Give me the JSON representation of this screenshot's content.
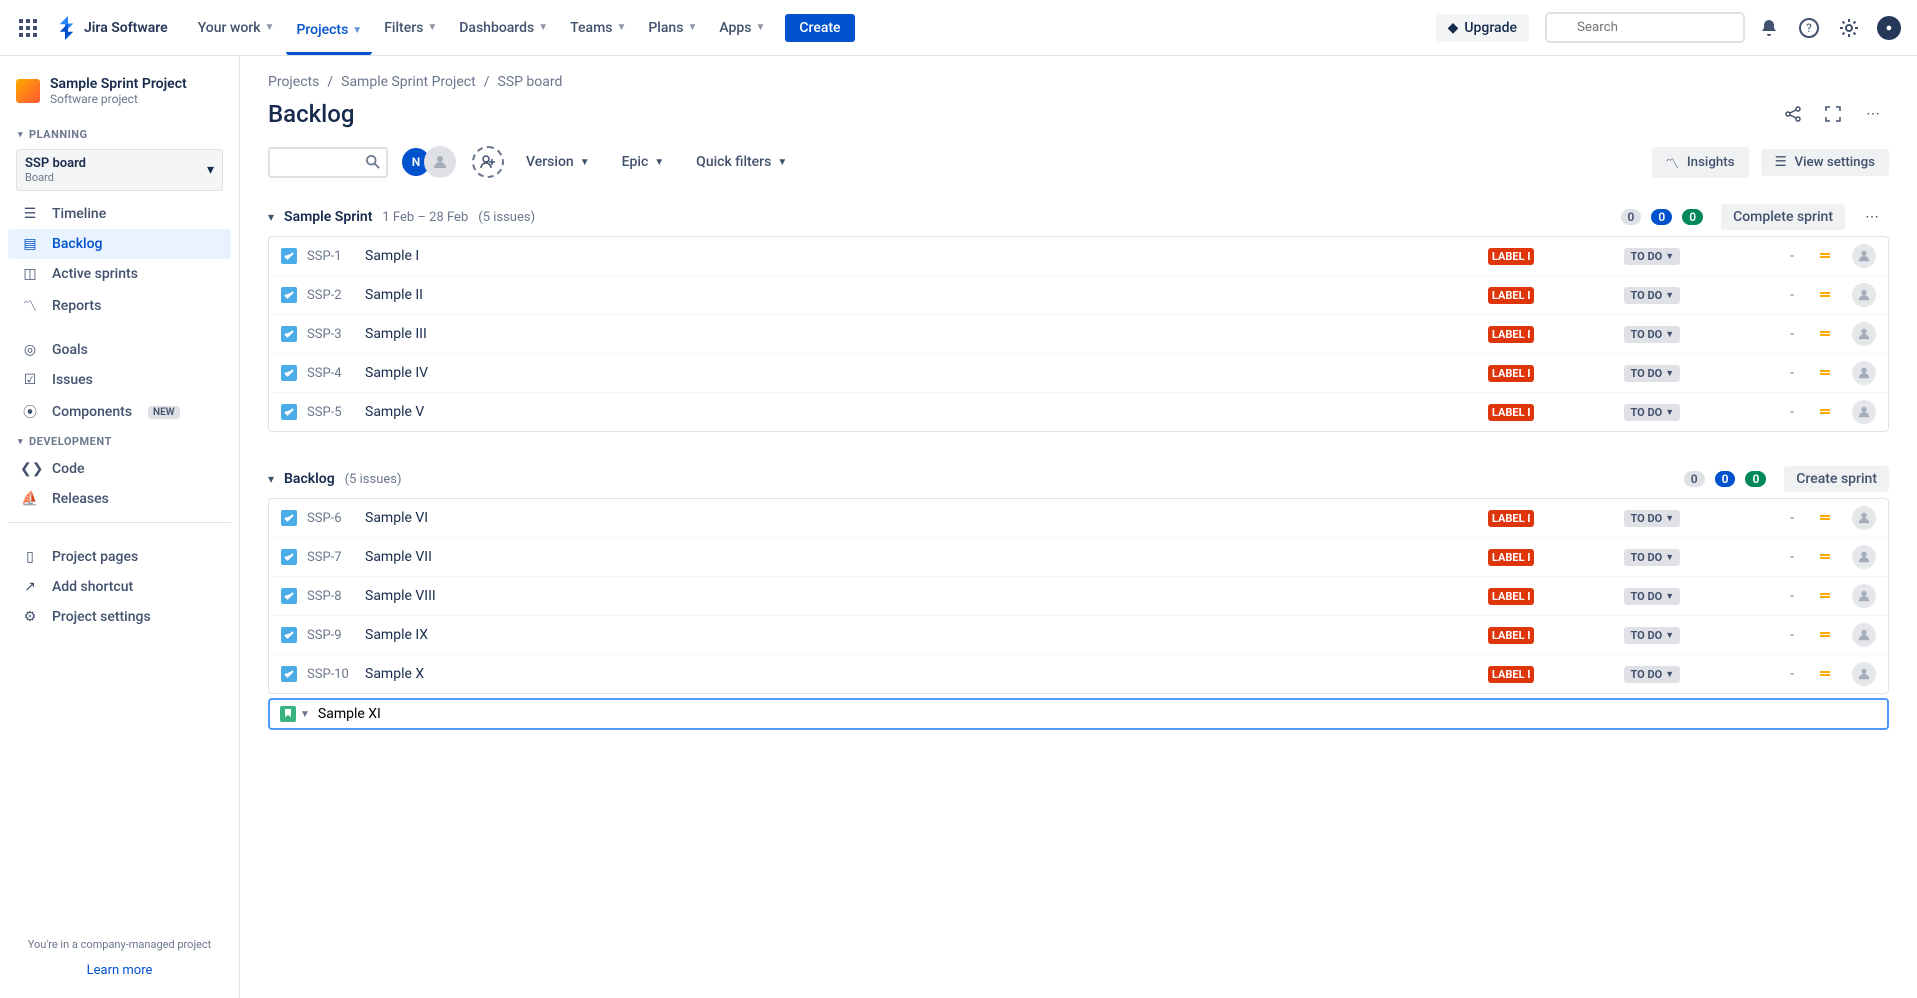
{
  "nav": {
    "logo_text": "Jira Software",
    "your_work": "Your work",
    "projects": "Projects",
    "filters": "Filters",
    "dashboards": "Dashboards",
    "teams": "Teams",
    "plans": "Plans",
    "apps": "Apps",
    "create": "Create",
    "upgrade": "Upgrade",
    "search_placeholder": "Search"
  },
  "sidebar": {
    "project_title": "Sample Sprint Project",
    "project_sub": "Software project",
    "planning": "PLANNING",
    "board_select": {
      "title": "SSP board",
      "sub": "Board"
    },
    "timeline": "Timeline",
    "backlog": "Backlog",
    "active_sprints": "Active sprints",
    "reports": "Reports",
    "goals": "Goals",
    "issues": "Issues",
    "components": "Components",
    "new_badge": "NEW",
    "development": "DEVELOPMENT",
    "code": "Code",
    "releases": "Releases",
    "project_pages": "Project pages",
    "add_shortcut": "Add shortcut",
    "project_settings": "Project settings",
    "footer": "You're in a company-managed project",
    "learn_more": "Learn more"
  },
  "breadcrumb": {
    "projects": "Projects",
    "project": "Sample Sprint Project",
    "board": "SSP board"
  },
  "page": {
    "title": "Backlog",
    "version": "Version",
    "epic": "Epic",
    "quick_filters": "Quick filters",
    "insights": "Insights",
    "view_settings": "View settings"
  },
  "sprint": {
    "name": "Sample Sprint",
    "dates": "1 Feb – 28 Feb",
    "count": "(5 issues)",
    "todo": "0",
    "inprog": "0",
    "done": "0",
    "complete": "Complete sprint",
    "issues": [
      {
        "key": "SSP-1",
        "summary": "Sample I",
        "label": "LABEL I",
        "status": "TO DO",
        "est": "-"
      },
      {
        "key": "SSP-2",
        "summary": "Sample II",
        "label": "LABEL I",
        "status": "TO DO",
        "est": "-"
      },
      {
        "key": "SSP-3",
        "summary": "Sample III",
        "label": "LABEL I",
        "status": "TO DO",
        "est": "-"
      },
      {
        "key": "SSP-4",
        "summary": "Sample IV",
        "label": "LABEL I",
        "status": "TO DO",
        "est": "-"
      },
      {
        "key": "SSP-5",
        "summary": "Sample V",
        "label": "LABEL I",
        "status": "TO DO",
        "est": "-"
      }
    ]
  },
  "backlog": {
    "name": "Backlog",
    "count": "(5 issues)",
    "todo": "0",
    "inprog": "0",
    "done": "0",
    "create_sprint": "Create sprint",
    "new_issue_value": "Sample XI",
    "issues": [
      {
        "key": "SSP-6",
        "summary": "Sample VI",
        "label": "LABEL I",
        "status": "TO DO",
        "est": "-"
      },
      {
        "key": "SSP-7",
        "summary": "Sample VII",
        "label": "LABEL I",
        "status": "TO DO",
        "est": "-"
      },
      {
        "key": "SSP-8",
        "summary": "Sample VIII",
        "label": "LABEL I",
        "status": "TO DO",
        "est": "-"
      },
      {
        "key": "SSP-9",
        "summary": "Sample IX",
        "label": "LABEL I",
        "status": "TO DO",
        "est": "-"
      },
      {
        "key": "SSP-10",
        "summary": "Sample X",
        "label": "LABEL I",
        "status": "TO DO",
        "est": "-"
      }
    ]
  }
}
